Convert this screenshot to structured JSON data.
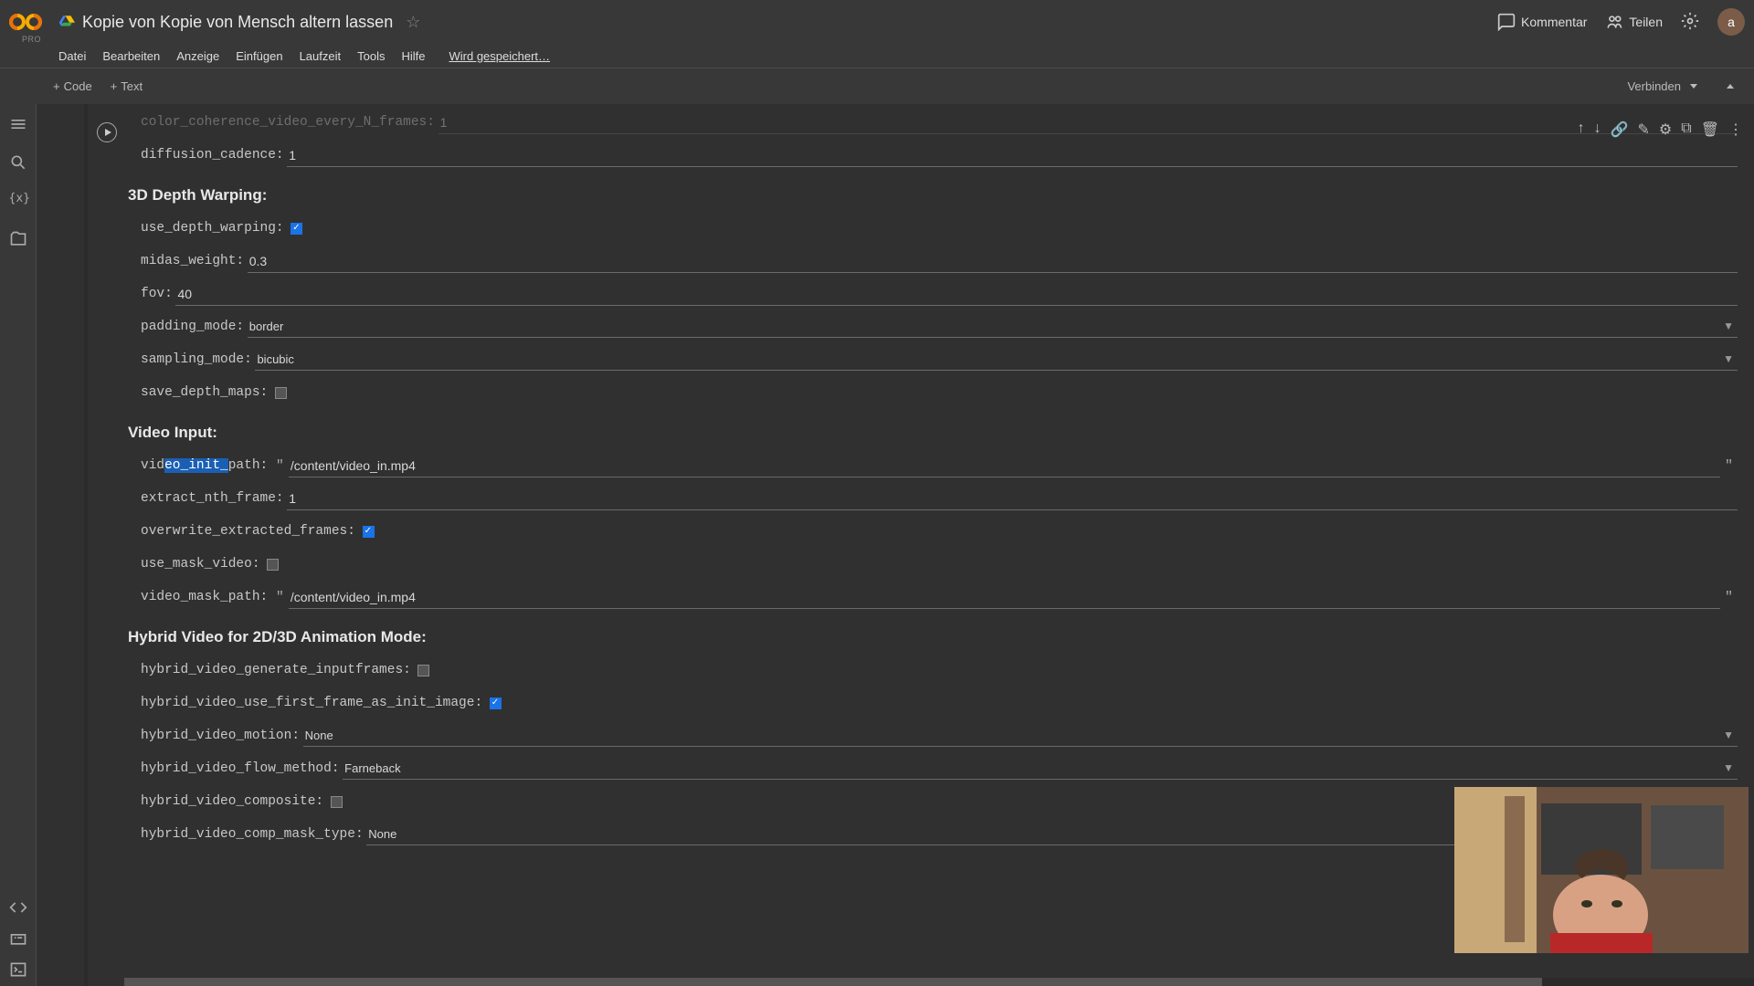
{
  "header": {
    "pro": "PRO",
    "title": "Kopie von Kopie von Mensch altern lassen",
    "comment": "Kommentar",
    "share": "Teilen",
    "avatar": "a"
  },
  "menu": {
    "file": "Datei",
    "edit": "Bearbeiten",
    "view": "Anzeige",
    "insert": "Einfügen",
    "runtime": "Laufzeit",
    "tools": "Tools",
    "help": "Hilfe",
    "saving": "Wird gespeichert…"
  },
  "toolbar": {
    "code": "Code",
    "text": "Text",
    "connect": "Verbinden"
  },
  "fields": {
    "color_coherence_label": "color_coherence_video_every_N_frames:",
    "color_coherence_value": "1",
    "diffusion_cadence_label": "diffusion_cadence:",
    "diffusion_cadence_value": "1"
  },
  "section_depth": "3D Depth Warping:",
  "depth": {
    "use_label": "use_depth_warping:",
    "midas_label": "midas_weight:",
    "midas_value": "0.3",
    "fov_label": "fov:",
    "fov_value": "40",
    "padding_label": "padding_mode:",
    "padding_value": "border",
    "sampling_label": "sampling_mode:",
    "sampling_value": "bicubic",
    "save_label": "save_depth_maps:"
  },
  "section_video": "Video Input:",
  "video": {
    "init_label_pre": "vid",
    "init_label_sel": "eo_init_",
    "init_label_post": "path:",
    "init_value": "/content/video_in.mp4",
    "nth_label": "extract_nth_frame:",
    "nth_value": "1",
    "overwrite_label": "overwrite_extracted_frames:",
    "mask_label": "use_mask_video:",
    "mask_path_label": "video_mask_path:",
    "mask_path_value": "/content/video_in.mp4"
  },
  "section_hybrid": "Hybrid Video for 2D/3D Animation Mode:",
  "hybrid": {
    "gen_label": "hybrid_video_generate_inputframes:",
    "first_label": "hybrid_video_use_first_frame_as_init_image:",
    "motion_label": "hybrid_video_motion:",
    "motion_value": "None",
    "flow_label": "hybrid_video_flow_method:",
    "flow_value": "Farneback",
    "composite_label": "hybrid_video_composite:",
    "mask_type_label": "hybrid_video_comp_mask_type:",
    "mask_type_value": "None"
  }
}
